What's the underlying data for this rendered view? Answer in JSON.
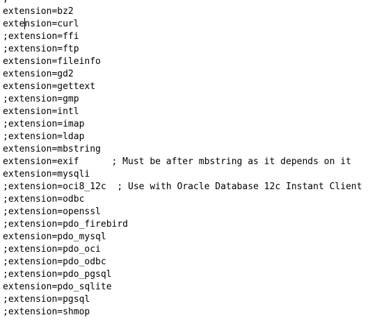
{
  "editor": {
    "lines": [
      ";",
      "extension=bz2",
      "extension=curl",
      ";extension=ffi",
      ";extension=ftp",
      "extension=fileinfo",
      "extension=gd2",
      "extension=gettext",
      ";extension=gmp",
      "extension=intl",
      ";extension=imap",
      ";extension=ldap",
      "extension=mbstring",
      "extension=exif      ; Must be after mbstring as it depends on it",
      "extension=mysqli",
      ";extension=oci8_12c  ; Use with Oracle Database 12c Instant Client",
      ";extension=odbc",
      ";extension=openssl",
      ";extension=pdo_firebird",
      "extension=pdo_mysql",
      ";extension=pdo_oci",
      ";extension=pdo_odbc",
      ";extension=pdo_pgsql",
      "extension=pdo_sqlite",
      ";extension=pgsql",
      ";extension=shmop"
    ]
  }
}
